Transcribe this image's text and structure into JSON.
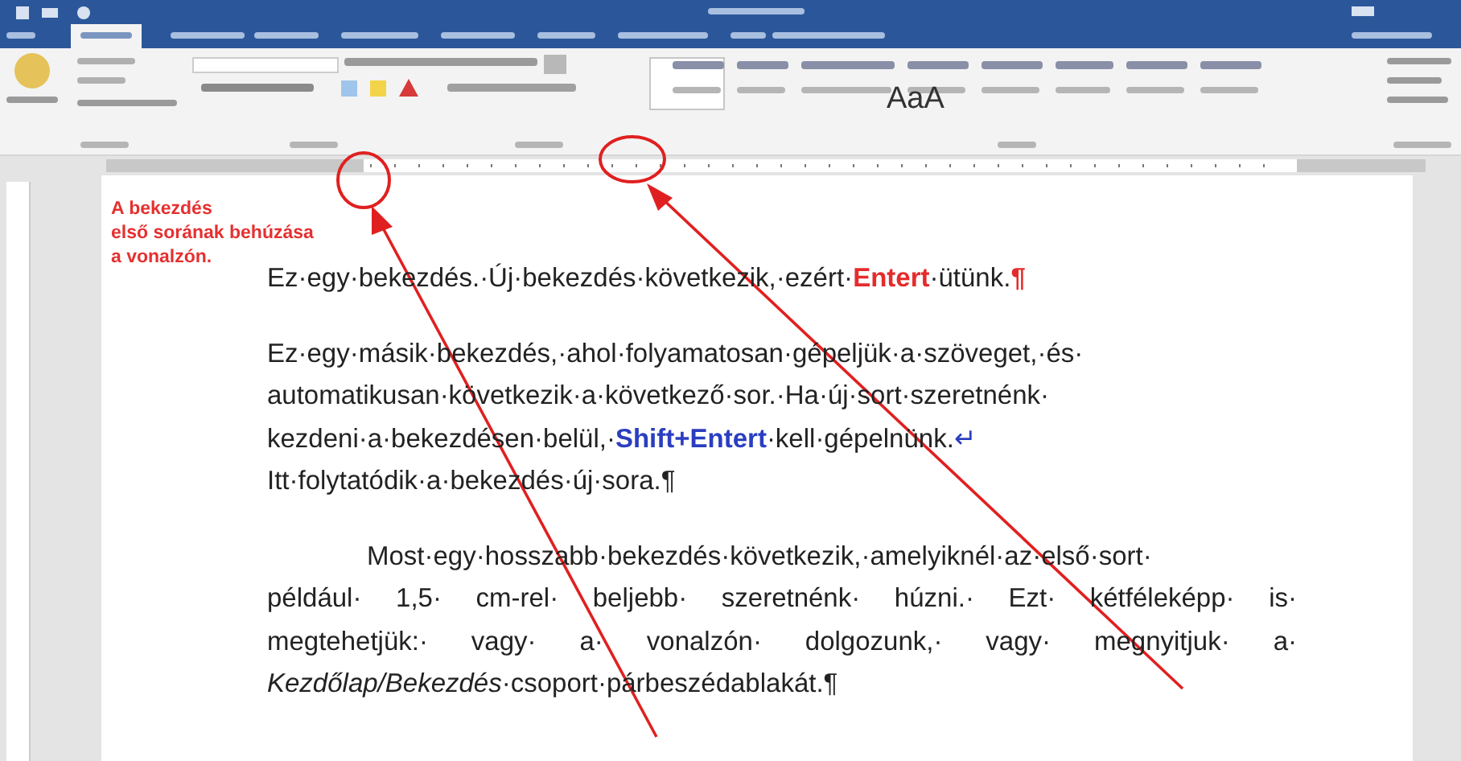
{
  "ribbon": {
    "style_preview": "AaA"
  },
  "note": {
    "lines": [
      "A bekezdés",
      "első sorának behúzása",
      "a vonalzón."
    ]
  },
  "document": {
    "paragraphs": [
      {
        "kind": "plain",
        "lines": [
          [
            {
              "text": "Ez·egy·bekezdés.·Új·bekezdés·következik,·ezért·",
              "kind": "normal"
            },
            {
              "text": "Entert",
              "kind": "red-bold"
            },
            {
              "text": "·ütünk.",
              "kind": "normal"
            },
            {
              "text": "¶",
              "kind": "red-bold"
            }
          ]
        ]
      },
      {
        "kind": "plain",
        "lines": [
          [
            {
              "text": "Ez·egy·másik·bekezdés,·ahol·folyamatosan·gépeljük·a·szöveget,·és·",
              "kind": "normal"
            }
          ],
          [
            {
              "text": "automatikusan·következik·a·következő·sor.·Ha·új·sort·szeretnénk·",
              "kind": "normal"
            }
          ],
          [
            {
              "text": "kezdeni·a·bekezdésen·belül,·",
              "kind": "normal"
            },
            {
              "text": "Shift+Entert",
              "kind": "blue-bold"
            },
            {
              "text": "·kell·gépelnünk.",
              "kind": "normal"
            },
            {
              "text": "↵",
              "kind": "blue"
            }
          ],
          [
            {
              "text": "Itt·folytatódik·a·bekezdés·új·sora.¶",
              "kind": "normal"
            }
          ]
        ]
      },
      {
        "kind": "justified-indent",
        "lines": [
          [
            {
              "text": "Most·egy·hosszabb·bekezdés·következik,·amelyiknél·az·első·sort·",
              "kind": "normal"
            }
          ],
          [
            {
              "text": "például· 1,5· cm-rel· beljebb· szeretnénk· húzni.· Ezt· kétféleképp· is·",
              "kind": "normal"
            }
          ],
          [
            {
              "text": "megtehetjük:· vagy· a· vonalzón· dolgozunk,· vagy· megnyitjuk· a·",
              "kind": "normal"
            }
          ],
          [
            {
              "text": "Kezdőlap/Bekezdés",
              "kind": "italic"
            },
            {
              "text": "·csoport·párbeszédablakát.¶",
              "kind": "normal"
            }
          ]
        ]
      }
    ]
  }
}
